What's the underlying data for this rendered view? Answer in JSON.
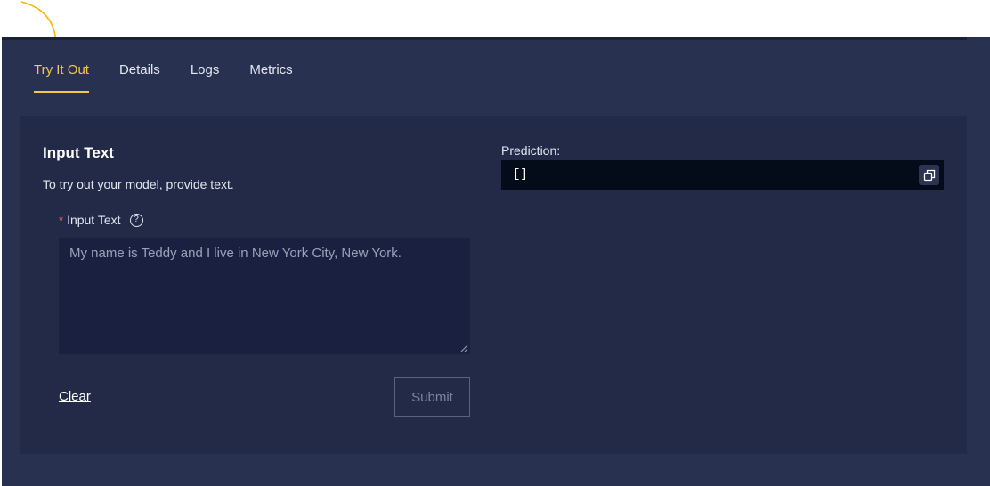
{
  "tabs": [
    {
      "label": "Try It Out",
      "active": true
    },
    {
      "label": "Details",
      "active": false
    },
    {
      "label": "Logs",
      "active": false
    },
    {
      "label": "Metrics",
      "active": false
    }
  ],
  "input_section": {
    "title": "Input Text",
    "description": "To try out your model, provide text.",
    "field_label": "Input Text",
    "required_marker": "*",
    "help_icon": "question-circle-icon",
    "placeholder": "My name is Teddy and I live in New York City, New York.",
    "value": ""
  },
  "actions": {
    "clear_label": "Clear",
    "submit_label": "Submit",
    "submit_enabled": false
  },
  "prediction": {
    "label": "Prediction:",
    "value": "[]",
    "copy_icon": "copy-icon"
  },
  "colors": {
    "accent": "#f2c94c",
    "background": "#283150",
    "panel": "#232a47",
    "input_background": "#1a2140",
    "code_background": "#040c19",
    "required": "#ff6b6b",
    "annotation_arrow": "#f5b800"
  }
}
